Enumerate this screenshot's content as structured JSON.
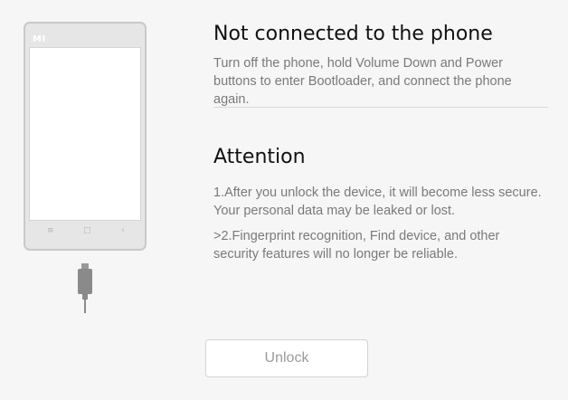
{
  "phone": {
    "logo": "MI",
    "nav_menu_glyph": "≡",
    "nav_home_glyph": "□",
    "nav_back_glyph": "‹"
  },
  "status": {
    "title": "Not connected to the phone",
    "description": "Turn off the phone, hold Volume Down and Power buttons to enter Bootloader, and connect the phone again."
  },
  "attention": {
    "title": "Attention",
    "notes": [
      "1.After you unlock the device, it will become less secure. Your personal data may be leaked or lost.",
      ">2.Fingerprint recognition, Find device, and other security features will no longer be reliable."
    ]
  },
  "actions": {
    "unlock_label": "Unlock"
  },
  "colors": {
    "background": "#f6f6f6",
    "phone_body": "#e6e6e6",
    "phone_border": "#c9c9c9",
    "cable": "#8a8a8a",
    "title_text": "#111111",
    "body_text": "#7a7a7a",
    "button_text_disabled": "#9a9a9a"
  }
}
